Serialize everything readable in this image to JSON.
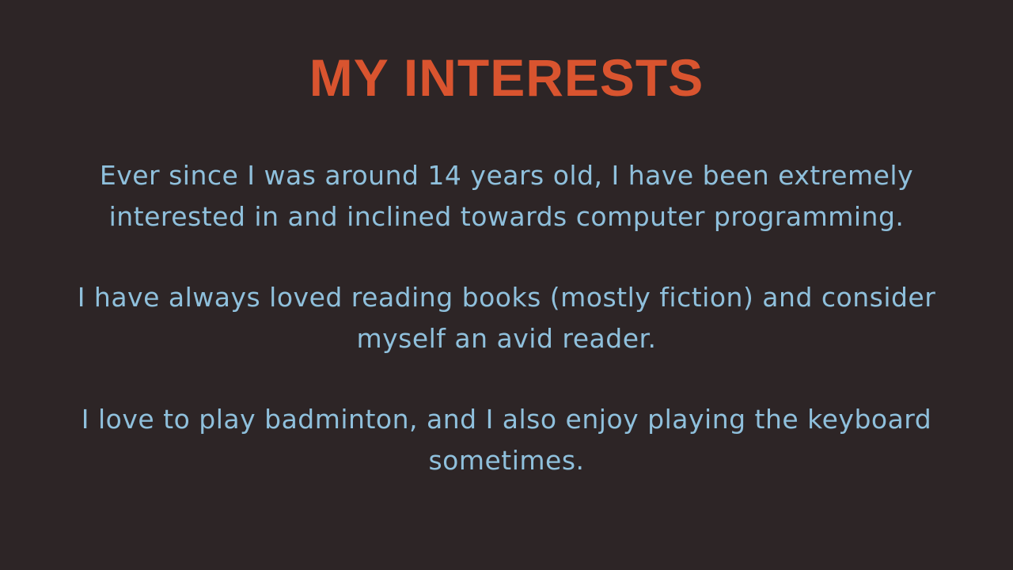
{
  "slide": {
    "title": "MY INTERESTS",
    "paragraphs": [
      "Ever since I was around 14 years old, I have been extremely interested in and inclined towards computer programming.",
      "I have always loved reading books (mostly fiction) and consider myself an avid reader.",
      "I love to play badminton, and I also enjoy playing the keyboard sometimes."
    ]
  },
  "colors": {
    "background": "#2d2526",
    "title": "#d9542f",
    "body_text": "#8fc0dc"
  }
}
